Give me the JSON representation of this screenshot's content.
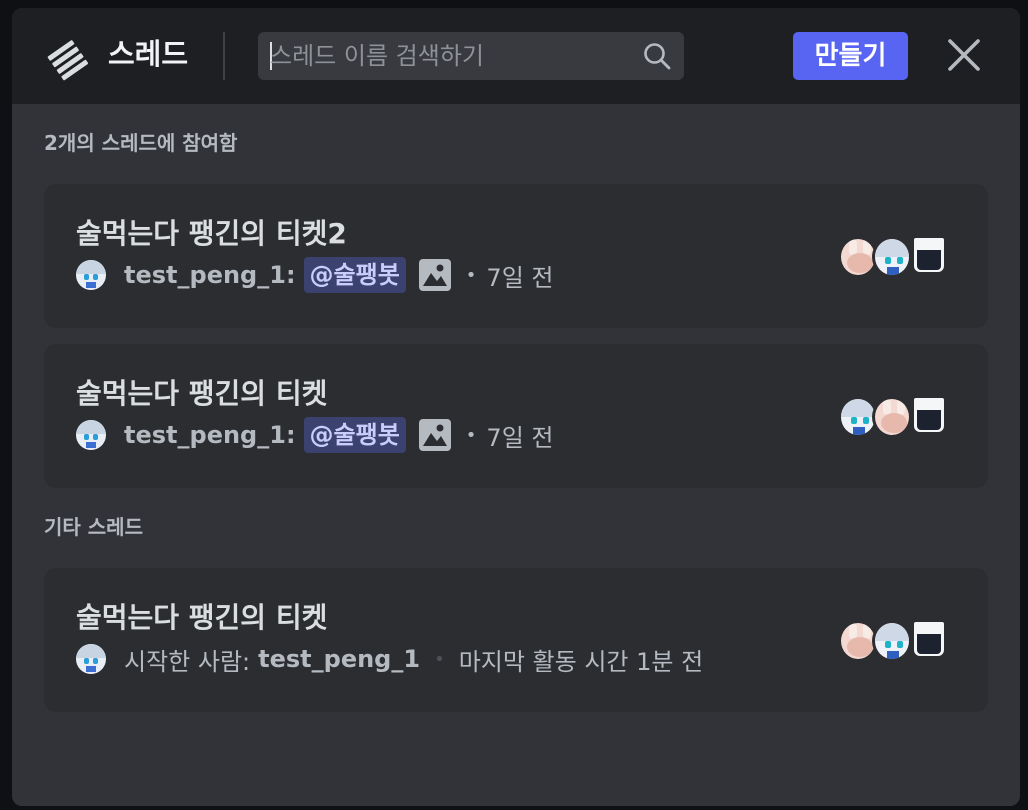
{
  "header": {
    "title": "스레드",
    "search_placeholder": "스레드 이름 검색하기",
    "create_label": "만들기"
  },
  "sections": [
    {
      "label": "2개의 스레드에 참여함",
      "threads": [
        {
          "title": "술먹는다 팽긴의 티켓2",
          "author": "test_peng_1",
          "mention": "@술팽봇",
          "time": "7일 전"
        },
        {
          "title": "술먹는다 팽긴의 티켓",
          "author": "test_peng_1",
          "mention": "@술팽봇",
          "time": "7일 전"
        }
      ]
    },
    {
      "label": "기타 스레드",
      "threads": [
        {
          "title": "술먹는다 팽긴의 티켓",
          "started_by_label": "시작한 사람:",
          "author": "test_peng_1",
          "last_activity": "마지막 활동 시간 1분 전"
        }
      ]
    }
  ],
  "colors": {
    "accent": "#5865f2",
    "modal_bg": "#313338",
    "card_bg": "#2b2d31",
    "mention_bg": "#3c4270"
  }
}
